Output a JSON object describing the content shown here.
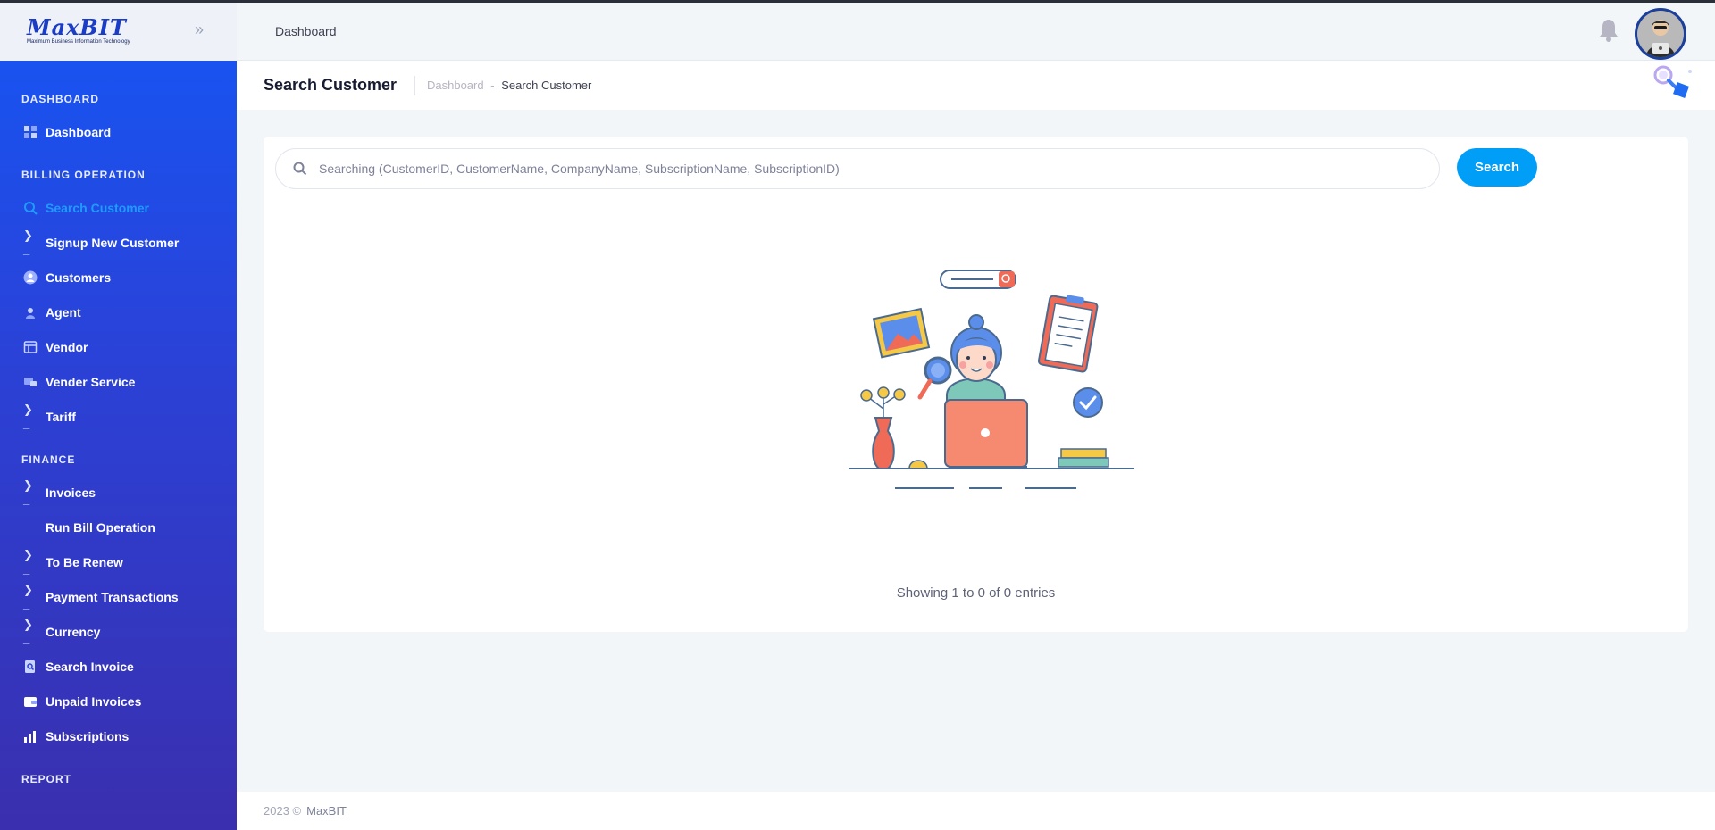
{
  "brand": {
    "name": "MaxBIT",
    "tagline": "Maximum Business Information Technology"
  },
  "header": {
    "title": "Dashboard"
  },
  "sidebar": {
    "sections": [
      {
        "label": "DASHBOARD"
      },
      {
        "label": "BILLING OPERATION"
      },
      {
        "label": "FINANCE"
      },
      {
        "label": "REPORT"
      }
    ],
    "items": [
      {
        "label": "Dashboard",
        "icon": "grid-icon"
      },
      {
        "label": "Search Customer",
        "icon": "search-icon",
        "active": true
      },
      {
        "label": "Signup New Customer",
        "icon": "terminal-icon"
      },
      {
        "label": "Customers",
        "icon": "user-icon"
      },
      {
        "label": "Agent",
        "icon": "agent-icon"
      },
      {
        "label": "Vendor",
        "icon": "vendor-icon"
      },
      {
        "label": "Vender Service",
        "icon": "service-icon"
      },
      {
        "label": "Tariff",
        "icon": "terminal-icon"
      },
      {
        "label": "Invoices",
        "icon": "terminal-icon"
      },
      {
        "label": "Run Bill Operation",
        "icon": ""
      },
      {
        "label": "To Be Renew",
        "icon": "terminal-icon"
      },
      {
        "label": "Payment Transactions",
        "icon": "terminal-icon"
      },
      {
        "label": "Currency",
        "icon": "terminal-icon"
      },
      {
        "label": "Search Invoice",
        "icon": "search-doc-icon"
      },
      {
        "label": "Unpaid Invoices",
        "icon": "wallet-icon"
      },
      {
        "label": "Subscriptions",
        "icon": "bar-chart-icon"
      }
    ]
  },
  "subheader": {
    "title": "Search Customer",
    "breadcrumb": [
      {
        "label": "Dashboard"
      },
      {
        "label": "-"
      },
      {
        "label": "Search Customer"
      }
    ]
  },
  "search": {
    "placeholder": "Searching (CustomerID, CustomerName, CompanyName, SubscriptionName, SubscriptionID)",
    "value": "",
    "button_label": "Search"
  },
  "results": {
    "summary": "Showing 1 to 0 of 0 entries"
  },
  "footer": {
    "year": "2023 ©",
    "brand": "MaxBIT"
  },
  "colors": {
    "accent": "#009ef7",
    "active_nav": "#1e9bff",
    "sidebar_top": "#1656f5",
    "sidebar_bottom": "#3a2fae"
  }
}
